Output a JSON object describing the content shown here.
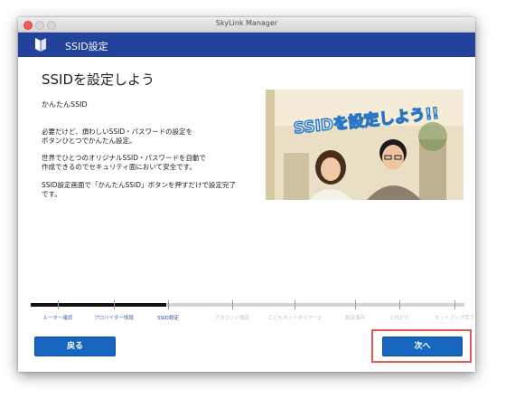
{
  "window": {
    "title": "SkyLink Manager"
  },
  "header": {
    "title": "SSID設定"
  },
  "content": {
    "title": "SSIDを設定しよう",
    "subheading": "かんたんSSID",
    "paragraphs": [
      [
        "必要だけど、煩わしいSSID・パスワードの設定を",
        "ボタンひとつでかんたん設定。"
      ],
      [
        "世界でひとつのオリジナルSSID・パスワードを自動で",
        "作成できるのでセキュリティ面において安全です。"
      ],
      [
        "SSID設定画面で「かんたんSSID」ボタンを押すだけで設定完了",
        "です。"
      ]
    ],
    "video_caption": "SSIDを設定しよう!!"
  },
  "progress": {
    "current_index": 2,
    "steps": [
      "ルーター確認",
      "プロバイダー情報",
      "SSID設定",
      "アカウント設定",
      "こどもネットタイマー2",
      "設定保存",
      "これだけ",
      "セットアップ完了"
    ]
  },
  "buttons": {
    "back": "戻る",
    "next": "次へ"
  },
  "colors": {
    "header": "#22429c",
    "button": "#1767c0",
    "highlight": "#de5b54",
    "progress_done": "#111111",
    "progress_pending": "#d4d4d4"
  }
}
